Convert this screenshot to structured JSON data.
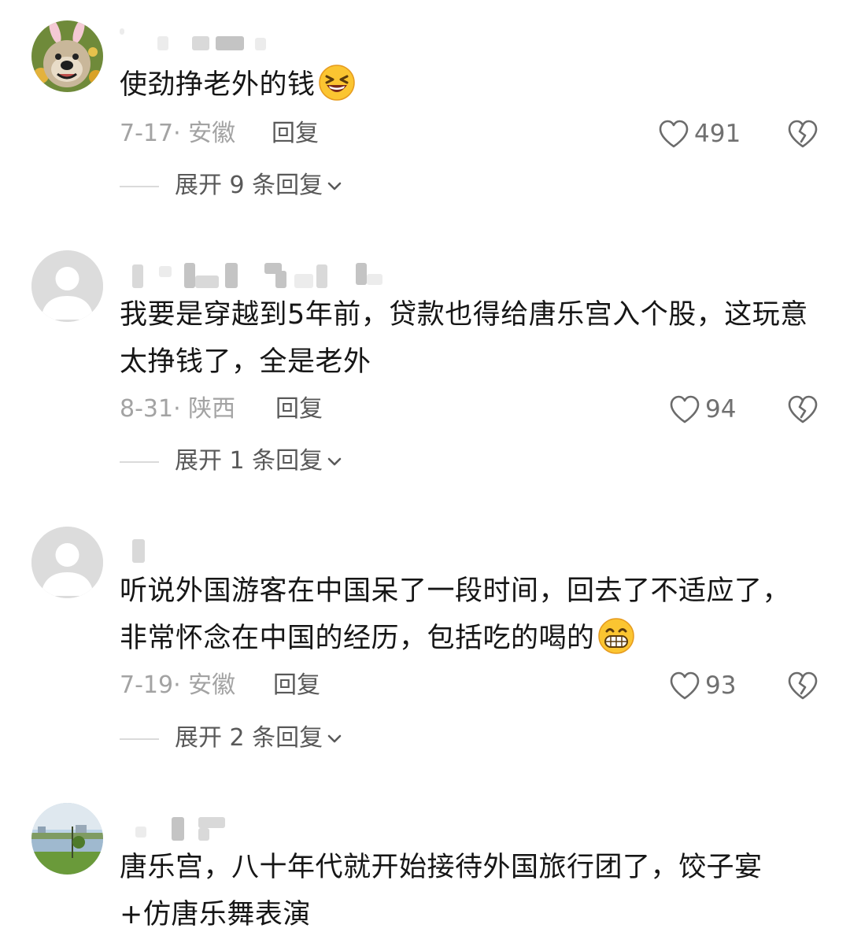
{
  "comments": [
    {
      "text": "使劲挣老外的钱",
      "emoji": "laughing-squint-emoji",
      "date": "7-17",
      "location": "安徽",
      "meta": "7-17· 安徽",
      "reply_label": "回复",
      "likes": "491",
      "expand_label": "展开 9 条回复",
      "avatar": "dog-with-bunny-ears-avatar"
    },
    {
      "text": "我要是穿越到5年前，贷款也得给唐乐宫入个股，这玩意太挣钱了，全是老外",
      "date": "8-31",
      "location": "陕西",
      "meta": "8-31· 陕西",
      "reply_label": "回复",
      "likes": "94",
      "expand_label": "展开 1 条回复",
      "avatar": "default-gray-avatar"
    },
    {
      "text": "听说外国游客在中国呆了一段时间，回去了不适应了，非常怀念在中国的经历，包括吃的喝的",
      "emoji": "grinning-teeth-emoji",
      "date": "7-19",
      "location": "安徽",
      "meta": "7-19· 安徽",
      "reply_label": "回复",
      "likes": "93",
      "expand_label": "展开 2 条回复",
      "avatar": "default-gray-avatar"
    },
    {
      "text": "唐乐宫，八十年代就开始接待外国旅行团了，饺子宴+仿唐乐舞表演",
      "avatar": "lake-landscape-avatar"
    }
  ],
  "colors": {
    "primary_text": "#161616",
    "secondary_text": "#a3a3a3",
    "action_text": "#595959",
    "icon_stroke": "#6b6b6b"
  }
}
